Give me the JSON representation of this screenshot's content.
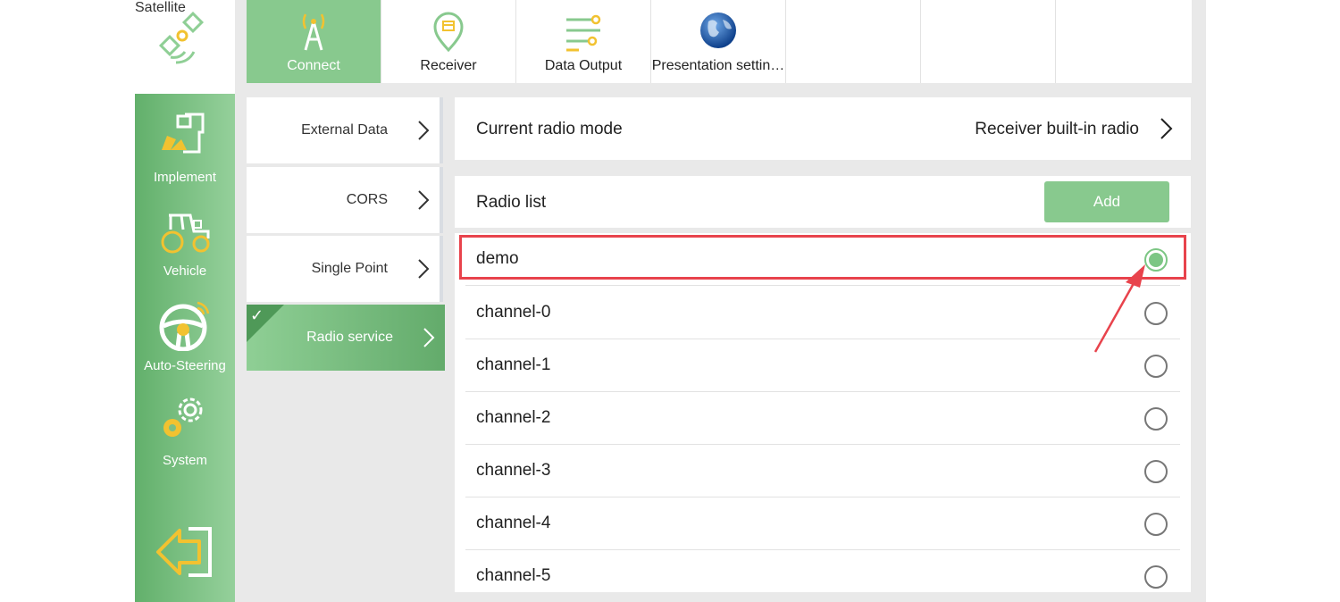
{
  "rail": {
    "items": [
      {
        "label": "Satellite",
        "icon": "satellite-icon"
      },
      {
        "label": "Implement",
        "icon": "implement-icon"
      },
      {
        "label": "Vehicle",
        "icon": "tractor-icon"
      },
      {
        "label": "Auto-Steering",
        "icon": "steering-wheel-icon"
      },
      {
        "label": "System",
        "icon": "gear-icon"
      }
    ],
    "exit_icon": "exit-arrow-icon"
  },
  "tabs": [
    {
      "label": "Connect",
      "icon": "antenna-icon",
      "active": true
    },
    {
      "label": "Receiver",
      "icon": "map-pin-icon"
    },
    {
      "label": "Data Output",
      "icon": "sliders-icon"
    },
    {
      "label": "Presentation settin…",
      "icon": "globe-icon"
    }
  ],
  "submenu": [
    {
      "label": "External Data"
    },
    {
      "label": "CORS"
    },
    {
      "label": "Single Point"
    },
    {
      "label": "Radio service",
      "active": true
    }
  ],
  "mode": {
    "title": "Current radio mode",
    "value": "Receiver built-in radio"
  },
  "radio_list": {
    "title": "Radio list",
    "add_label": "Add",
    "selected": "demo",
    "items": [
      "demo",
      "channel-0",
      "channel-1",
      "channel-2",
      "channel-3",
      "channel-4",
      "channel-5"
    ]
  },
  "colors": {
    "accent": "#88c98e",
    "rail": "#62b06b",
    "highlight": "#e8434c",
    "icon_yellow": "#f2c230"
  }
}
